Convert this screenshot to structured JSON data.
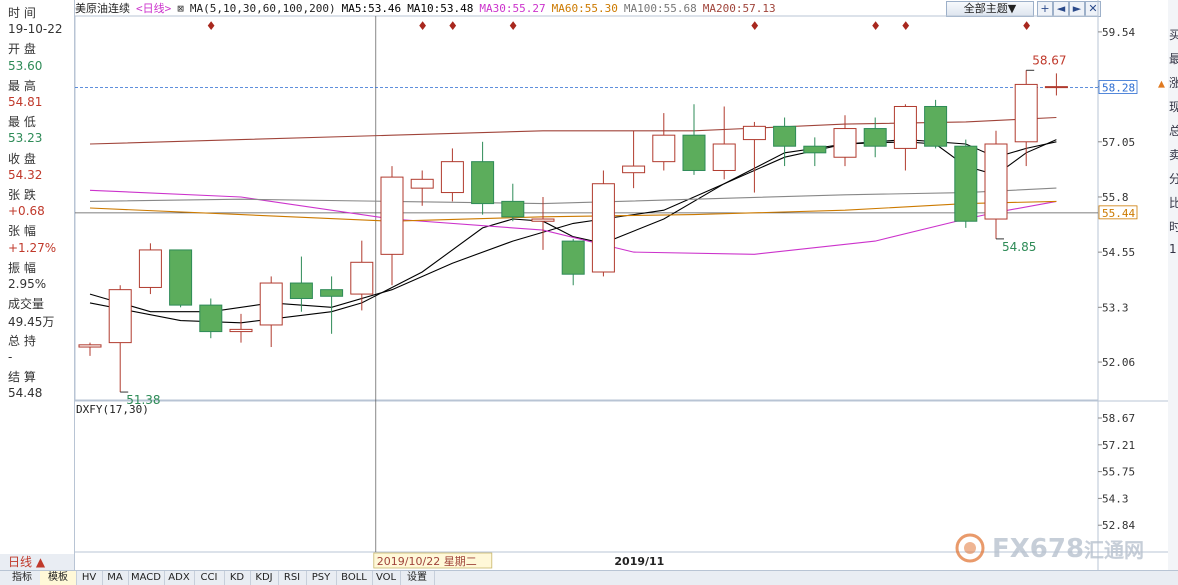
{
  "window": {
    "instrument": "美原油连续",
    "period": "<日线>",
    "ma_label": "MA(5,10,30,60,100,200)",
    "ma_values": [
      {
        "label": "MA5:53.46",
        "color": "#000000"
      },
      {
        "label": "MA10:53.48",
        "color": "#000000"
      },
      {
        "label": "MA30:55.27",
        "color": "#cc33cc"
      },
      {
        "label": "MA60:55.30",
        "color": "#cc7a00"
      },
      {
        "label": "MA100:55.68",
        "color": "#777777"
      },
      {
        "label": "MA200:57.13",
        "color": "#a0443a"
      }
    ],
    "theme_button": "全部主题▼",
    "toolbar_icons": [
      "+",
      "◄",
      "►",
      "✕"
    ]
  },
  "info_panel": [
    {
      "text": "时 间",
      "cls": ""
    },
    {
      "text": "19-10-22",
      "cls": ""
    },
    {
      "text": "开 盘",
      "cls": ""
    },
    {
      "text": "53.60",
      "cls": "green"
    },
    {
      "text": "最 高",
      "cls": ""
    },
    {
      "text": "54.81",
      "cls": "red"
    },
    {
      "text": "最 低",
      "cls": ""
    },
    {
      "text": "53.23",
      "cls": "green"
    },
    {
      "text": "收 盘",
      "cls": ""
    },
    {
      "text": "54.32",
      "cls": "red"
    },
    {
      "text": "张 跌",
      "cls": ""
    },
    {
      "text": "+0.68",
      "cls": "red"
    },
    {
      "text": "张 幅",
      "cls": ""
    },
    {
      "text": "+1.27%",
      "cls": "red"
    },
    {
      "text": "振 幅",
      "cls": ""
    },
    {
      "text": "2.95%",
      "cls": ""
    },
    {
      "text": "成交量",
      "cls": ""
    },
    {
      "text": "49.45万",
      "cls": ""
    },
    {
      "text": "总 持",
      "cls": ""
    },
    {
      "text": "-",
      "cls": ""
    },
    {
      "text": "结 算",
      "cls": ""
    },
    {
      "text": "54.48",
      "cls": ""
    }
  ],
  "right_strip": [
    "买",
    "最",
    "涨",
    "现",
    "总",
    "卖",
    "分",
    "比",
    "时",
    "1"
  ],
  "indicator": {
    "label": "DXFY(17,30)"
  },
  "crosshair": {
    "date_label": "2019/10/22 星期二"
  },
  "month_label": "2019/11",
  "day_line_label": "日线 ▲",
  "bottom_tabs": [
    "指标",
    "模板",
    "HV",
    "MA",
    "MACD",
    "ADX",
    "CCI",
    "KD",
    "KDJ",
    "RSI",
    "PSY",
    "BOLL",
    "VOL",
    "设置"
  ],
  "watermark": {
    "text": "FX678",
    "cn": "汇通网"
  },
  "chart_data": {
    "type": "candlestick",
    "y_axis_main": {
      "ticks": [
        59.54,
        58.3,
        57.05,
        55.8,
        54.55,
        53.3,
        52.06
      ],
      "range": [
        51.2,
        59.9
      ]
    },
    "y_axis_indicator": {
      "ticks": [
        58.67,
        57.21,
        55.75,
        54.3,
        52.84
      ]
    },
    "price_tags": [
      {
        "value": 58.28,
        "label": "58.28",
        "color": "#2a6bd1"
      },
      {
        "value": 55.44,
        "label": "55.44",
        "color": "#cc7a00"
      }
    ],
    "annotations": [
      {
        "index": 1,
        "value": 51.38,
        "label": "51.38",
        "color": "#2e8b57",
        "pos": "below"
      },
      {
        "index": 30,
        "value": 54.85,
        "label": "54.85",
        "color": "#2e8b57",
        "pos": "below"
      },
      {
        "index": 31,
        "value": 58.67,
        "label": "58.67",
        "color": "#c0392b",
        "pos": "above"
      }
    ],
    "event_marker_indices": [
      4,
      11,
      12,
      14,
      22,
      26,
      27,
      31
    ],
    "candles": [
      {
        "o": 52.4,
        "h": 52.5,
        "l": 52.2,
        "c": 52.45
      },
      {
        "o": 52.5,
        "h": 53.8,
        "l": 51.38,
        "c": 53.7
      },
      {
        "o": 53.75,
        "h": 54.75,
        "l": 53.6,
        "c": 54.6
      },
      {
        "o": 54.6,
        "h": 54.6,
        "l": 53.3,
        "c": 53.35
      },
      {
        "o": 53.35,
        "h": 53.5,
        "l": 52.6,
        "c": 52.75
      },
      {
        "o": 52.75,
        "h": 53.15,
        "l": 52.5,
        "c": 52.8
      },
      {
        "o": 52.9,
        "h": 54.0,
        "l": 52.4,
        "c": 53.85
      },
      {
        "o": 53.85,
        "h": 54.45,
        "l": 53.2,
        "c": 53.5
      },
      {
        "o": 53.7,
        "h": 54.0,
        "l": 52.7,
        "c": 53.55
      },
      {
        "o": 53.6,
        "h": 54.81,
        "l": 53.23,
        "c": 54.32
      },
      {
        "o": 54.5,
        "h": 56.5,
        "l": 53.8,
        "c": 56.25
      },
      {
        "o": 56.0,
        "h": 56.4,
        "l": 55.6,
        "c": 56.2
      },
      {
        "o": 55.9,
        "h": 56.9,
        "l": 55.7,
        "c": 56.6
      },
      {
        "o": 56.6,
        "h": 57.05,
        "l": 55.4,
        "c": 55.65
      },
      {
        "o": 55.7,
        "h": 56.1,
        "l": 55.25,
        "c": 55.35
      },
      {
        "o": 55.25,
        "h": 55.8,
        "l": 54.6,
        "c": 55.3
      },
      {
        "o": 54.8,
        "h": 54.85,
        "l": 53.8,
        "c": 54.05
      },
      {
        "o": 54.1,
        "h": 56.4,
        "l": 54.0,
        "c": 56.1
      },
      {
        "o": 56.35,
        "h": 57.3,
        "l": 56.0,
        "c": 56.5
      },
      {
        "o": 56.6,
        "h": 57.7,
        "l": 56.4,
        "c": 57.2
      },
      {
        "o": 57.2,
        "h": 57.9,
        "l": 56.3,
        "c": 56.4
      },
      {
        "o": 56.4,
        "h": 57.85,
        "l": 56.2,
        "c": 57.0
      },
      {
        "o": 57.1,
        "h": 57.5,
        "l": 55.9,
        "c": 57.4
      },
      {
        "o": 57.4,
        "h": 57.6,
        "l": 56.5,
        "c": 56.95
      },
      {
        "o": 56.95,
        "h": 57.15,
        "l": 56.5,
        "c": 56.8
      },
      {
        "o": 56.7,
        "h": 57.65,
        "l": 56.5,
        "c": 57.35
      },
      {
        "o": 57.35,
        "h": 57.6,
        "l": 56.7,
        "c": 56.95
      },
      {
        "o": 56.9,
        "h": 57.9,
        "l": 56.4,
        "c": 57.85
      },
      {
        "o": 57.85,
        "h": 58.0,
        "l": 56.9,
        "c": 56.95
      },
      {
        "o": 56.95,
        "h": 57.1,
        "l": 55.1,
        "c": 55.25
      },
      {
        "o": 55.3,
        "h": 57.3,
        "l": 54.85,
        "c": 57.0
      },
      {
        "o": 57.05,
        "h": 58.67,
        "l": 56.5,
        "c": 58.35
      },
      {
        "o": 58.3,
        "h": 58.6,
        "l": 58.1,
        "c": 58.3
      }
    ],
    "ma_series": [
      {
        "name": "MA5",
        "color": "#000000",
        "points": [
          [
            0,
            53.4
          ],
          [
            3,
            53.0
          ],
          [
            5,
            52.95
          ],
          [
            8,
            53.2
          ],
          [
            9,
            53.4
          ],
          [
            11,
            54.1
          ],
          [
            13,
            55.1
          ],
          [
            14,
            55.3
          ],
          [
            15,
            55.25
          ],
          [
            16,
            54.9
          ],
          [
            17,
            54.75
          ],
          [
            19,
            55.3
          ],
          [
            21,
            56.1
          ],
          [
            23,
            56.8
          ],
          [
            25,
            57.0
          ],
          [
            27,
            57.05
          ],
          [
            28,
            57.0
          ],
          [
            29,
            56.5
          ],
          [
            30,
            56.3
          ],
          [
            31,
            56.8
          ],
          [
            32,
            57.1
          ]
        ]
      },
      {
        "name": "MA10",
        "color": "#000000",
        "points": [
          [
            0,
            53.6
          ],
          [
            2,
            53.2
          ],
          [
            4,
            53.2
          ],
          [
            6,
            53.4
          ],
          [
            8,
            53.3
          ],
          [
            10,
            53.7
          ],
          [
            12,
            54.3
          ],
          [
            14,
            54.8
          ],
          [
            16,
            55.2
          ],
          [
            17,
            55.3
          ],
          [
            19,
            55.5
          ],
          [
            21,
            56.1
          ],
          [
            23,
            56.7
          ],
          [
            25,
            57.0
          ],
          [
            27,
            57.1
          ],
          [
            29,
            57.0
          ],
          [
            30,
            56.7
          ],
          [
            31,
            56.9
          ],
          [
            32,
            57.05
          ]
        ]
      },
      {
        "name": "MA30",
        "color": "#cc33cc",
        "points": [
          [
            0,
            55.95
          ],
          [
            5,
            55.8
          ],
          [
            10,
            55.3
          ],
          [
            15,
            55.05
          ],
          [
            18,
            54.55
          ],
          [
            22,
            54.5
          ],
          [
            26,
            54.8
          ],
          [
            29,
            55.3
          ],
          [
            30,
            55.45
          ],
          [
            32,
            55.7
          ]
        ]
      },
      {
        "name": "MA60",
        "color": "#cc7a00",
        "points": [
          [
            0,
            55.55
          ],
          [
            5,
            55.4
          ],
          [
            10,
            55.25
          ],
          [
            15,
            55.35
          ],
          [
            20,
            55.4
          ],
          [
            25,
            55.5
          ],
          [
            29,
            55.65
          ],
          [
            32,
            55.7
          ]
        ]
      },
      {
        "name": "MA100",
        "color": "#888888",
        "points": [
          [
            0,
            55.7
          ],
          [
            5,
            55.75
          ],
          [
            10,
            55.7
          ],
          [
            15,
            55.65
          ],
          [
            20,
            55.75
          ],
          [
            25,
            55.85
          ],
          [
            29,
            55.9
          ],
          [
            32,
            56.0
          ]
        ]
      },
      {
        "name": "MA200",
        "color": "#a0443a",
        "points": [
          [
            0,
            57.0
          ],
          [
            5,
            57.1
          ],
          [
            10,
            57.2
          ],
          [
            15,
            57.3
          ],
          [
            20,
            57.3
          ],
          [
            25,
            57.45
          ],
          [
            29,
            57.5
          ],
          [
            32,
            57.6
          ]
        ]
      }
    ],
    "crosshair_index": 9,
    "crosshair_value": 55.44
  }
}
